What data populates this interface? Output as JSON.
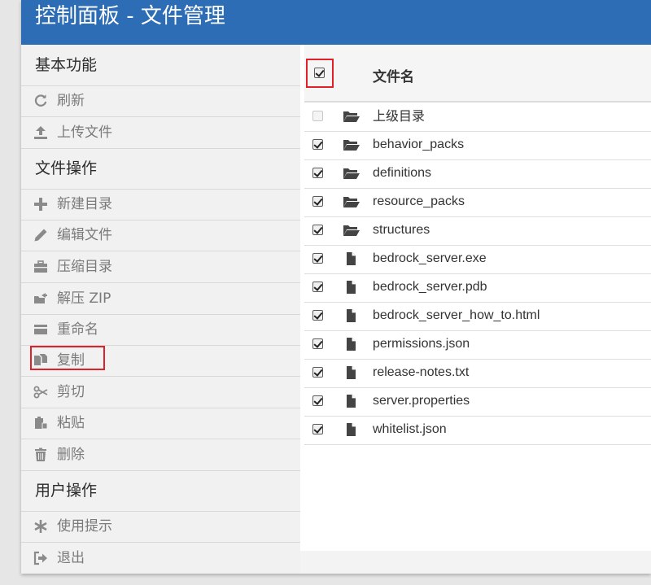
{
  "header": {
    "title": "控制面板 - 文件管理"
  },
  "sidebar": {
    "sections": [
      {
        "title": "基本功能",
        "items": [
          {
            "label": "刷新",
            "icon": "refresh-icon"
          },
          {
            "label": "上传文件",
            "icon": "upload-icon"
          }
        ]
      },
      {
        "title": "文件操作",
        "items": [
          {
            "label": "新建目录",
            "icon": "plus-icon"
          },
          {
            "label": "编辑文件",
            "icon": "pencil-icon"
          },
          {
            "label": "压缩目录",
            "icon": "briefcase-icon"
          },
          {
            "label": "解压 ZIP",
            "icon": "folder-open-icon"
          },
          {
            "label": "重命名",
            "icon": "card-icon"
          },
          {
            "label": "复制",
            "icon": "copy-icon",
            "highlighted": true
          },
          {
            "label": "剪切",
            "icon": "scissors-icon"
          },
          {
            "label": "粘贴",
            "icon": "paste-icon"
          },
          {
            "label": "删除",
            "icon": "trash-icon"
          }
        ]
      },
      {
        "title": "用户操作",
        "items": [
          {
            "label": "使用提示",
            "icon": "asterisk-icon"
          },
          {
            "label": "退出",
            "icon": "logout-icon"
          }
        ]
      }
    ]
  },
  "file_table": {
    "header": {
      "name_label": "文件名",
      "select_all_checked": true
    },
    "rows": [
      {
        "name": "上级目录",
        "type": "folder",
        "checked": false,
        "disabled": true
      },
      {
        "name": "behavior_packs",
        "type": "folder",
        "checked": true
      },
      {
        "name": "definitions",
        "type": "folder",
        "checked": true
      },
      {
        "name": "resource_packs",
        "type": "folder",
        "checked": true
      },
      {
        "name": "structures",
        "type": "folder",
        "checked": true
      },
      {
        "name": "bedrock_server.exe",
        "type": "file",
        "checked": true
      },
      {
        "name": "bedrock_server.pdb",
        "type": "file",
        "checked": true
      },
      {
        "name": "bedrock_server_how_to.html",
        "type": "file",
        "checked": true
      },
      {
        "name": "permissions.json",
        "type": "file",
        "checked": true
      },
      {
        "name": "release-notes.txt",
        "type": "file",
        "checked": true
      },
      {
        "name": "server.properties",
        "type": "file",
        "checked": true
      },
      {
        "name": "whitelist.json",
        "type": "file",
        "checked": true
      }
    ]
  },
  "colors": {
    "header_bg": "#2d6db5",
    "highlight_border": "#e0212a"
  }
}
